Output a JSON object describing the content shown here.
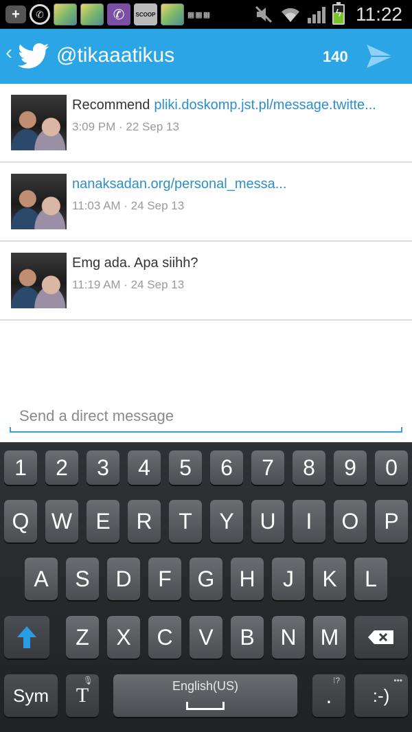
{
  "status_bar": {
    "time": "11:22",
    "scoop_label": "SCOOP",
    "icons": [
      "plus-icon",
      "whatsapp-icon",
      "app-thumb-icon",
      "app-thumb-icon",
      "viber-icon",
      "scoop-icon",
      "app-thumb-icon",
      "keyboard-icon",
      "mute-icon",
      "wifi-icon",
      "signal-icon",
      "battery-charging-icon"
    ]
  },
  "action_bar": {
    "username": "@tikaaatikus",
    "char_count": "140",
    "accent_color": "#2ba5e6"
  },
  "messages": [
    {
      "text": "Recommend",
      "link": "pliki.doskomp.jst.pl/message.twitte...",
      "time": "3:09 PM · 22 Sep 13"
    },
    {
      "text": "",
      "link": "nanaksadan.org/personal_messa...",
      "time": "11:03 AM · 24 Sep 13"
    },
    {
      "text": "Emg ada. Apa siihh?",
      "link": "",
      "time": "11:19 AM · 24 Sep 13"
    }
  ],
  "compose": {
    "placeholder": "Send a direct message"
  },
  "keyboard": {
    "row_numbers": [
      "1",
      "2",
      "3",
      "4",
      "5",
      "6",
      "7",
      "8",
      "9",
      "0"
    ],
    "row_1": [
      "Q",
      "W",
      "E",
      "R",
      "T",
      "Y",
      "U",
      "I",
      "O",
      "P"
    ],
    "row_2": [
      "A",
      "S",
      "D",
      "F",
      "G",
      "H",
      "J",
      "K",
      "L"
    ],
    "row_3": [
      "Z",
      "X",
      "C",
      "V",
      "B",
      "N",
      "M"
    ],
    "sym_label": "Sym",
    "text_tool_label": "T",
    "space_label": "English(US)",
    "period_label": ".",
    "smiley_label": ":-)"
  }
}
